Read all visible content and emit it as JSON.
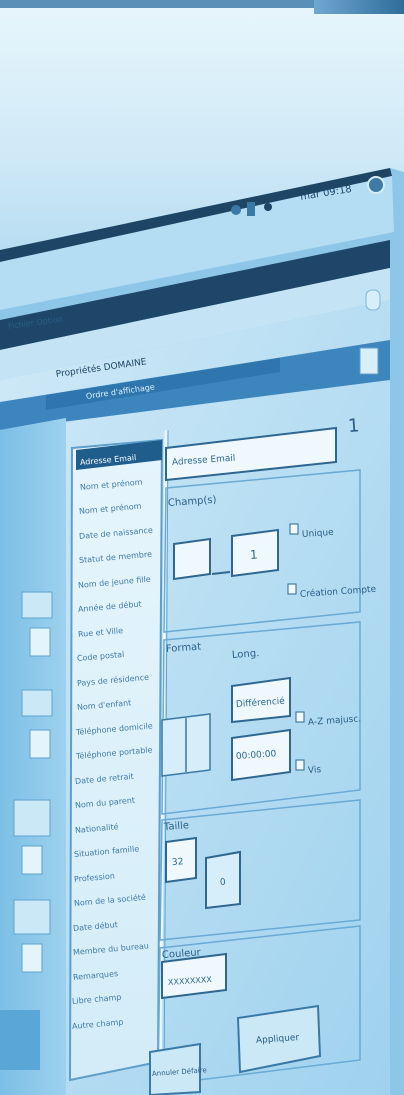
{
  "taskbar": {
    "clock": "mar 09:18"
  },
  "window": {
    "menu": "Fichier   Option",
    "title": "Propriétés DOMAINE",
    "subtitle": "Ordre d'affichage"
  },
  "list": {
    "items": [
      "Adresse Email",
      "Nom et prénom",
      "Nom et prénom",
      "Date de naissance",
      "Statut de membre",
      "Nom de jeune fille",
      "Année de début",
      "Rue et Ville",
      "Code postal",
      "Pays de résidence",
      "Nom d'enfant",
      "Téléphone domicile",
      "Téléphone portable",
      "Date de retrait",
      "Nom du parent",
      "Nationalité",
      "Situation famille",
      "Profession",
      "Nom de la société",
      "Date début",
      "Membre du bureau",
      "Remarques",
      "Libre champ",
      "Autre champ"
    ]
  },
  "form": {
    "address_value": "Adresse Email",
    "type_label": "Champ(s)",
    "type_value": "1",
    "opt_required": "Unique",
    "opt_unique": "Création Compte",
    "format_label": "Format",
    "length_label": "Long.",
    "format_value": "Différencié",
    "length_value": "00:00:00",
    "chk_upper": "A-Z majusc.",
    "chk_vis": "Vis",
    "size_label": "Taille",
    "size_value": "32",
    "size_min": "0",
    "color_label": "Couleur",
    "color_value": "XXXXXXXX",
    "apply_button": "Appliquer",
    "cancel_button": "Annuler Défaire",
    "page_number": "1"
  }
}
